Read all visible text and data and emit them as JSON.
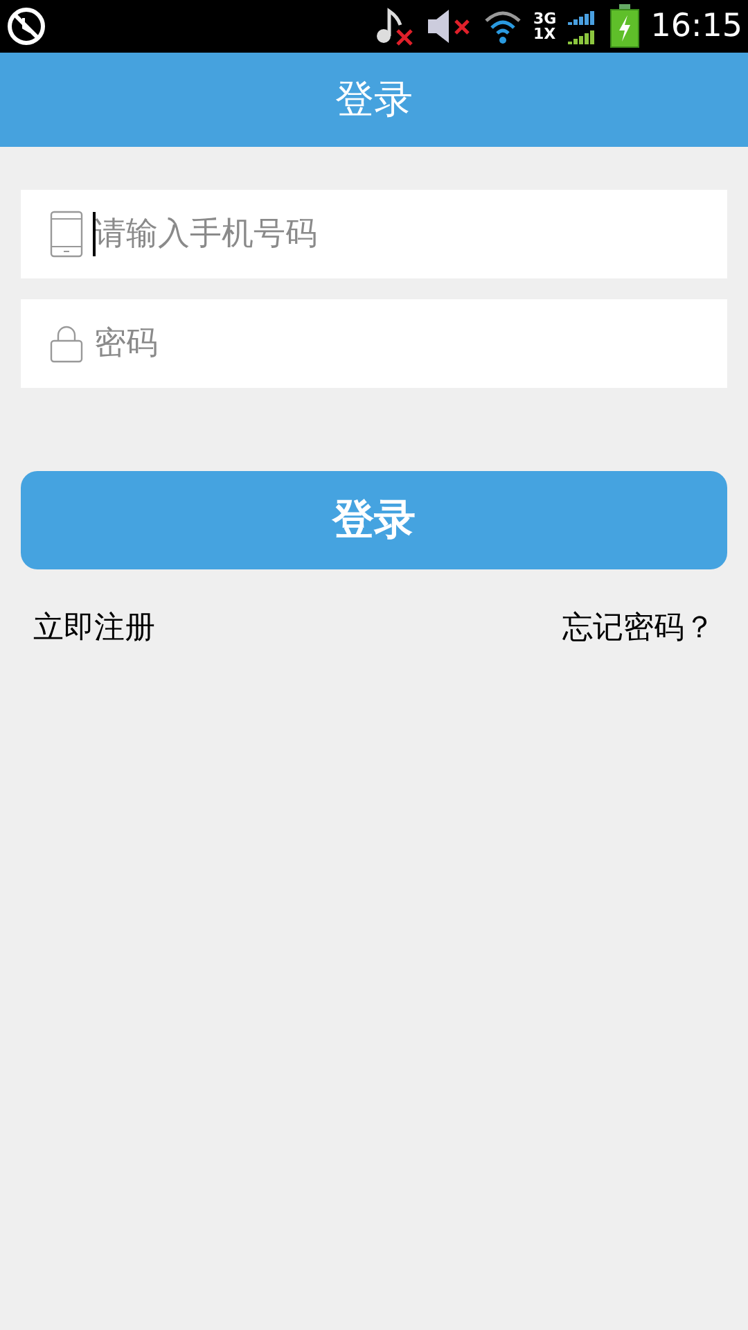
{
  "status_bar": {
    "network_top": "3G",
    "network_bottom": "1X",
    "time": "16:15"
  },
  "header": {
    "title": "登录"
  },
  "fields": [
    {
      "kind": "phone",
      "placeholder": "请输入手机号码",
      "focused": true
    },
    {
      "kind": "password",
      "placeholder": "密码",
      "focused": false
    }
  ],
  "login_button": "登录",
  "links": {
    "register": "立即注册",
    "forgot": "忘记密码？"
  }
}
